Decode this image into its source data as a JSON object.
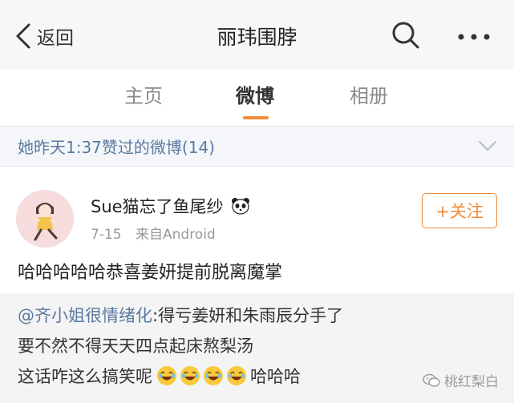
{
  "header": {
    "back_label": "返回",
    "title": "丽玮围脖",
    "icons": {
      "back": "chevron-left-icon",
      "search": "search-icon",
      "more": "more-dots-icon"
    }
  },
  "tabs": [
    {
      "label": "主页",
      "active": false
    },
    {
      "label": "微博",
      "active": true
    },
    {
      "label": "相册",
      "active": false
    }
  ],
  "likes_bar": {
    "text": "她昨天1:37赞过的微博(14)",
    "icon": "chevron-down-icon"
  },
  "post": {
    "author": "Sue猫忘了鱼尾纱",
    "author_badge": "panda-emoji",
    "date": "7-15",
    "source": "来自Android",
    "follow_label": "+关注",
    "text": "哈哈哈哈哈恭喜姜妍提前脱离魔掌"
  },
  "repost": {
    "mention": "@齐小姐很情绪化",
    "line1_rest": ":得亏姜妍和朱雨辰分手了",
    "line2": "要不然不得天天四点起床熬梨汤",
    "line3_text": "这话咋这么搞笑呢",
    "emoji_count": 4,
    "line3_after": "哈哈哈"
  },
  "watermark": {
    "text": "桃红梨白",
    "icon": "wechat-icon"
  },
  "colors": {
    "accent": "#f08b3a",
    "link": "#5a7aa3",
    "top_bg": "#f7f7f7",
    "repost_bg": "#f4f4f4",
    "likes_bg": "#f4f6f9"
  }
}
